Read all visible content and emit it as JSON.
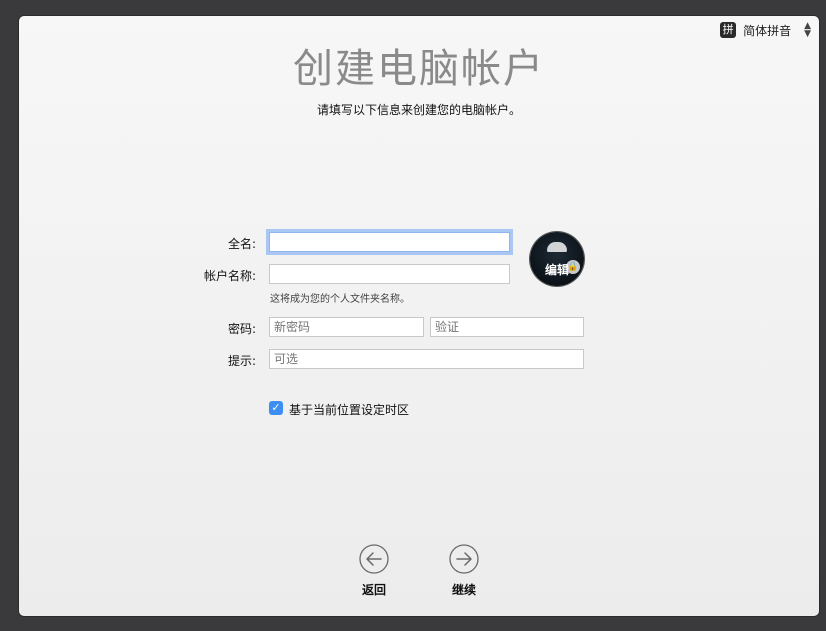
{
  "input_menu": {
    "icon_glyph": "拼",
    "label": "简体拼音",
    "chevron_up": "▲",
    "chevron_down": "▼"
  },
  "page": {
    "title": "创建电脑帐户",
    "subtitle": "请填写以下信息来创建您的电脑帐户。"
  },
  "form": {
    "full_name": {
      "label": "全名:",
      "value": "",
      "placeholder": ""
    },
    "account_name": {
      "label": "帐户名称:",
      "value": "",
      "placeholder": "",
      "hint": "这将成为您的个人文件夹名称。"
    },
    "password": {
      "label": "密码:",
      "placeholder": "新密码"
    },
    "verify": {
      "placeholder": "验证"
    },
    "hint_field": {
      "label": "提示:",
      "placeholder": "可选"
    },
    "avatar": {
      "edit_label": "编辑"
    },
    "timezone_checkbox": {
      "label": "基于当前位置设定时区",
      "checked": true,
      "check_glyph": "✓"
    }
  },
  "nav": {
    "back_label": "返回",
    "continue_label": "继续"
  },
  "colors": {
    "accent": "#3d8ef2",
    "title": "#8a8a8a"
  }
}
